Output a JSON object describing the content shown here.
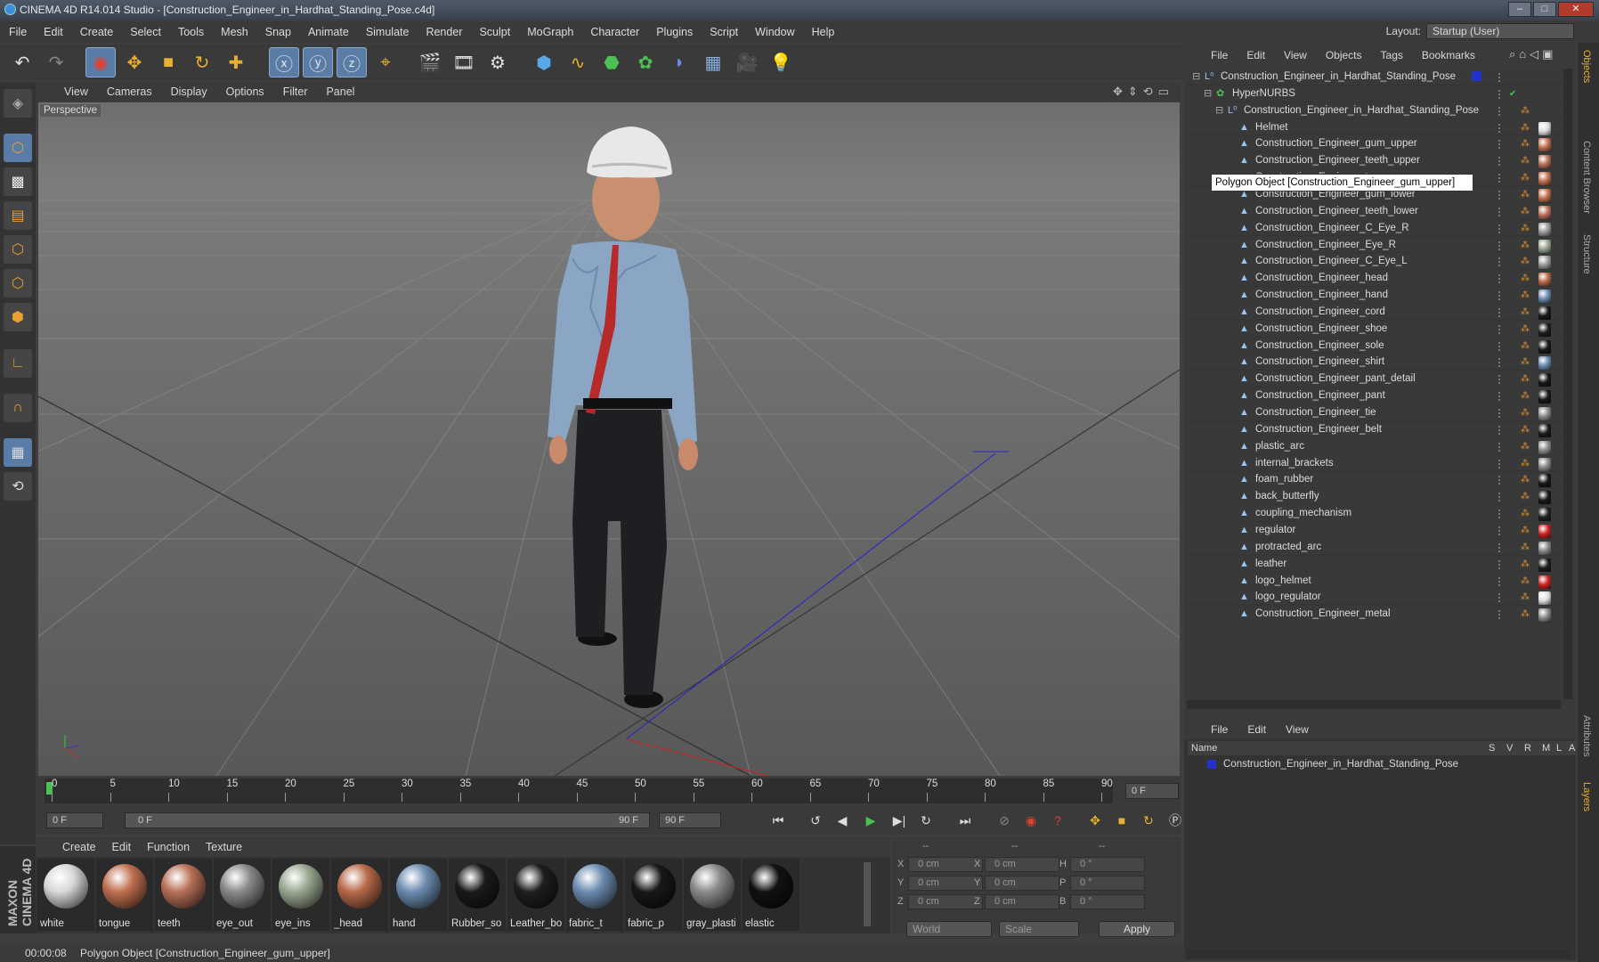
{
  "title": "CINEMA 4D R14.014 Studio - [Construction_Engineer_in_Hardhat_Standing_Pose.c4d]",
  "menu": [
    "File",
    "Edit",
    "Create",
    "Select",
    "Tools",
    "Mesh",
    "Snap",
    "Animate",
    "Simulate",
    "Render",
    "Sculpt",
    "MoGraph",
    "Character",
    "Plugins",
    "Script",
    "Window",
    "Help"
  ],
  "layout": {
    "label": "Layout:",
    "value": "Startup (User)"
  },
  "viewport": {
    "menu": [
      "View",
      "Cameras",
      "Display",
      "Options",
      "Filter",
      "Panel"
    ],
    "label": "Perspective"
  },
  "timeline": {
    "ticks": [
      "0",
      "5",
      "10",
      "15",
      "20",
      "25",
      "30",
      "35",
      "40",
      "45",
      "50",
      "55",
      "60",
      "65",
      "70",
      "75",
      "80",
      "85",
      "90"
    ],
    "frame_display": "0 F"
  },
  "transport": {
    "start": "0 F",
    "range_start": "0 F",
    "range_end": "90 F",
    "end": "90 F"
  },
  "material_menu": [
    "Create",
    "Edit",
    "Function",
    "Texture"
  ],
  "materials": [
    {
      "name": "white",
      "color": "#d8d8d8"
    },
    {
      "name": "tongue",
      "color": "#c07050"
    },
    {
      "name": "teeth",
      "color": "#b87058"
    },
    {
      "name": "eye_out",
      "color": "#8a8a8a"
    },
    {
      "name": "eye_ins",
      "color": "#9aa890"
    },
    {
      "name": "_head",
      "color": "#b86a4a"
    },
    {
      "name": "hand",
      "color": "#6c8cb0"
    },
    {
      "name": "Rubber_so",
      "color": "#1a1a1a"
    },
    {
      "name": "Leather_bo",
      "color": "#1e1e1e"
    },
    {
      "name": "fabric_t",
      "color": "#6c8cb0"
    },
    {
      "name": "fabric_p",
      "color": "#181818"
    },
    {
      "name": "gray_plasti",
      "color": "#8a8a8a"
    },
    {
      "name": "elastic",
      "color": "#111111"
    }
  ],
  "coords": {
    "headers": [
      "--",
      "--",
      "--"
    ],
    "rows": [
      {
        "a": "X",
        "av": "0 cm",
        "b": "X",
        "bv": "0 cm",
        "c": "H",
        "cv": "0 °"
      },
      {
        "a": "Y",
        "av": "0 cm",
        "b": "Y",
        "bv": "0 cm",
        "c": "P",
        "cv": "0 °"
      },
      {
        "a": "Z",
        "av": "0 cm",
        "b": "Z",
        "bv": "0 cm",
        "c": "B",
        "cv": "0 °"
      }
    ],
    "world": "World",
    "scale": "Scale",
    "apply": "Apply"
  },
  "status": {
    "time": "00:00:08",
    "message": "Polygon Object [Construction_Engineer_gum_upper]"
  },
  "objects_menu": [
    "File",
    "Edit",
    "View",
    "Objects",
    "Tags",
    "Bookmarks"
  ],
  "objects": [
    {
      "name": "Construction_Engineer_in_Hardhat_Standing_Pose",
      "indent": 0,
      "type": "null",
      "tag": "#2233cc"
    },
    {
      "name": "HyperNURBS",
      "indent": 1,
      "type": "nurbs",
      "tag": ""
    },
    {
      "name": "Construction_Engineer_in_Hardhat_Standing_Pose",
      "indent": 2,
      "type": "null",
      "tag": ""
    },
    {
      "name": "Helmet",
      "indent": 3,
      "type": "poly",
      "tag": "#dddddd"
    },
    {
      "name": "Construction_Engineer_gum_upper",
      "indent": 3,
      "type": "poly",
      "tag": "#c07050"
    },
    {
      "name": "Construction_Engineer_teeth_upper",
      "indent": 3,
      "type": "poly",
      "tag": "#b87058"
    },
    {
      "name": "Construction_Engineer_tongue",
      "indent": 3,
      "type": "poly",
      "tag": "#c07050"
    },
    {
      "name": "Construction_Engineer_gum_lower",
      "indent": 3,
      "type": "poly",
      "tag": "#c07050"
    },
    {
      "name": "Construction_Engineer_teeth_lower",
      "indent": 3,
      "type": "poly",
      "tag": "#b87058"
    },
    {
      "name": "Construction_Engineer_C_Eye_R",
      "indent": 3,
      "type": "poly",
      "tag": "#9a9a9a"
    },
    {
      "name": "Construction_Engineer_Eye_R",
      "indent": 3,
      "type": "poly",
      "tag": "#9aa890"
    },
    {
      "name": "Construction_Engineer_C_Eye_L",
      "indent": 3,
      "type": "poly",
      "tag": "#9a9a9a"
    },
    {
      "name": "Construction_Engineer_head",
      "indent": 3,
      "type": "poly",
      "tag": "#b86a4a"
    },
    {
      "name": "Construction_Engineer_hand",
      "indent": 3,
      "type": "poly",
      "tag": "#6c8cb0"
    },
    {
      "name": "Construction_Engineer_cord",
      "indent": 3,
      "type": "poly",
      "tag": "#1a1a1a"
    },
    {
      "name": "Construction_Engineer_shoe",
      "indent": 3,
      "type": "poly",
      "tag": "#1e1e1e"
    },
    {
      "name": "Construction_Engineer_sole",
      "indent": 3,
      "type": "poly",
      "tag": "#1a1a1a"
    },
    {
      "name": "Construction_Engineer_shirt",
      "indent": 3,
      "type": "poly",
      "tag": "#6c8cb0"
    },
    {
      "name": "Construction_Engineer_pant_detail",
      "indent": 3,
      "type": "poly",
      "tag": "#181818"
    },
    {
      "name": "Construction_Engineer_pant",
      "indent": 3,
      "type": "poly",
      "tag": "#181818"
    },
    {
      "name": "Construction_Engineer_tie",
      "indent": 3,
      "type": "poly",
      "tag": "#8a8a8a"
    },
    {
      "name": "Construction_Engineer_belt",
      "indent": 3,
      "type": "poly",
      "tag": "#1e1e1e"
    },
    {
      "name": "plastic_arc",
      "indent": 3,
      "type": "poly",
      "tag": "#8a8a8a"
    },
    {
      "name": "internal_brackets",
      "indent": 3,
      "type": "poly",
      "tag": "#8a8a8a"
    },
    {
      "name": "foam_rubber",
      "indent": 3,
      "type": "poly",
      "tag": "#1a1a1a"
    },
    {
      "name": "back_butterfly",
      "indent": 3,
      "type": "poly",
      "tag": "#1a1a1a"
    },
    {
      "name": "coupling_mechanism",
      "indent": 3,
      "type": "poly",
      "tag": "#222222"
    },
    {
      "name": "regulator",
      "indent": 3,
      "type": "poly",
      "tag": "#cc2222"
    },
    {
      "name": "protracted_arc",
      "indent": 3,
      "type": "poly",
      "tag": "#8a8a8a"
    },
    {
      "name": "leather",
      "indent": 3,
      "type": "poly",
      "tag": "#1e1e1e"
    },
    {
      "name": "logo_helmet",
      "indent": 3,
      "type": "poly",
      "tag": "#cc2222"
    },
    {
      "name": "logo_regulator",
      "indent": 3,
      "type": "poly",
      "tag": "#dddddd"
    },
    {
      "name": "Construction_Engineer_metal",
      "indent": 3,
      "type": "poly",
      "tag": "#8a8a8a"
    }
  ],
  "tooltip": "Polygon Object [Construction_Engineer_gum_upper]",
  "layers_menu": [
    "File",
    "Edit",
    "View"
  ],
  "layers_header": {
    "name": "Name",
    "cols": [
      "S",
      "V",
      "R",
      "M",
      "L",
      "A"
    ]
  },
  "layers": [
    {
      "name": "Construction_Engineer_in_Hardhat_Standing_Pose",
      "color": "#2233cc"
    }
  ],
  "side_tabs": [
    "Objects",
    "Content Browser",
    "Structure",
    "Attributes",
    "Layers"
  ],
  "brand": "MAXON CINEMA 4D"
}
